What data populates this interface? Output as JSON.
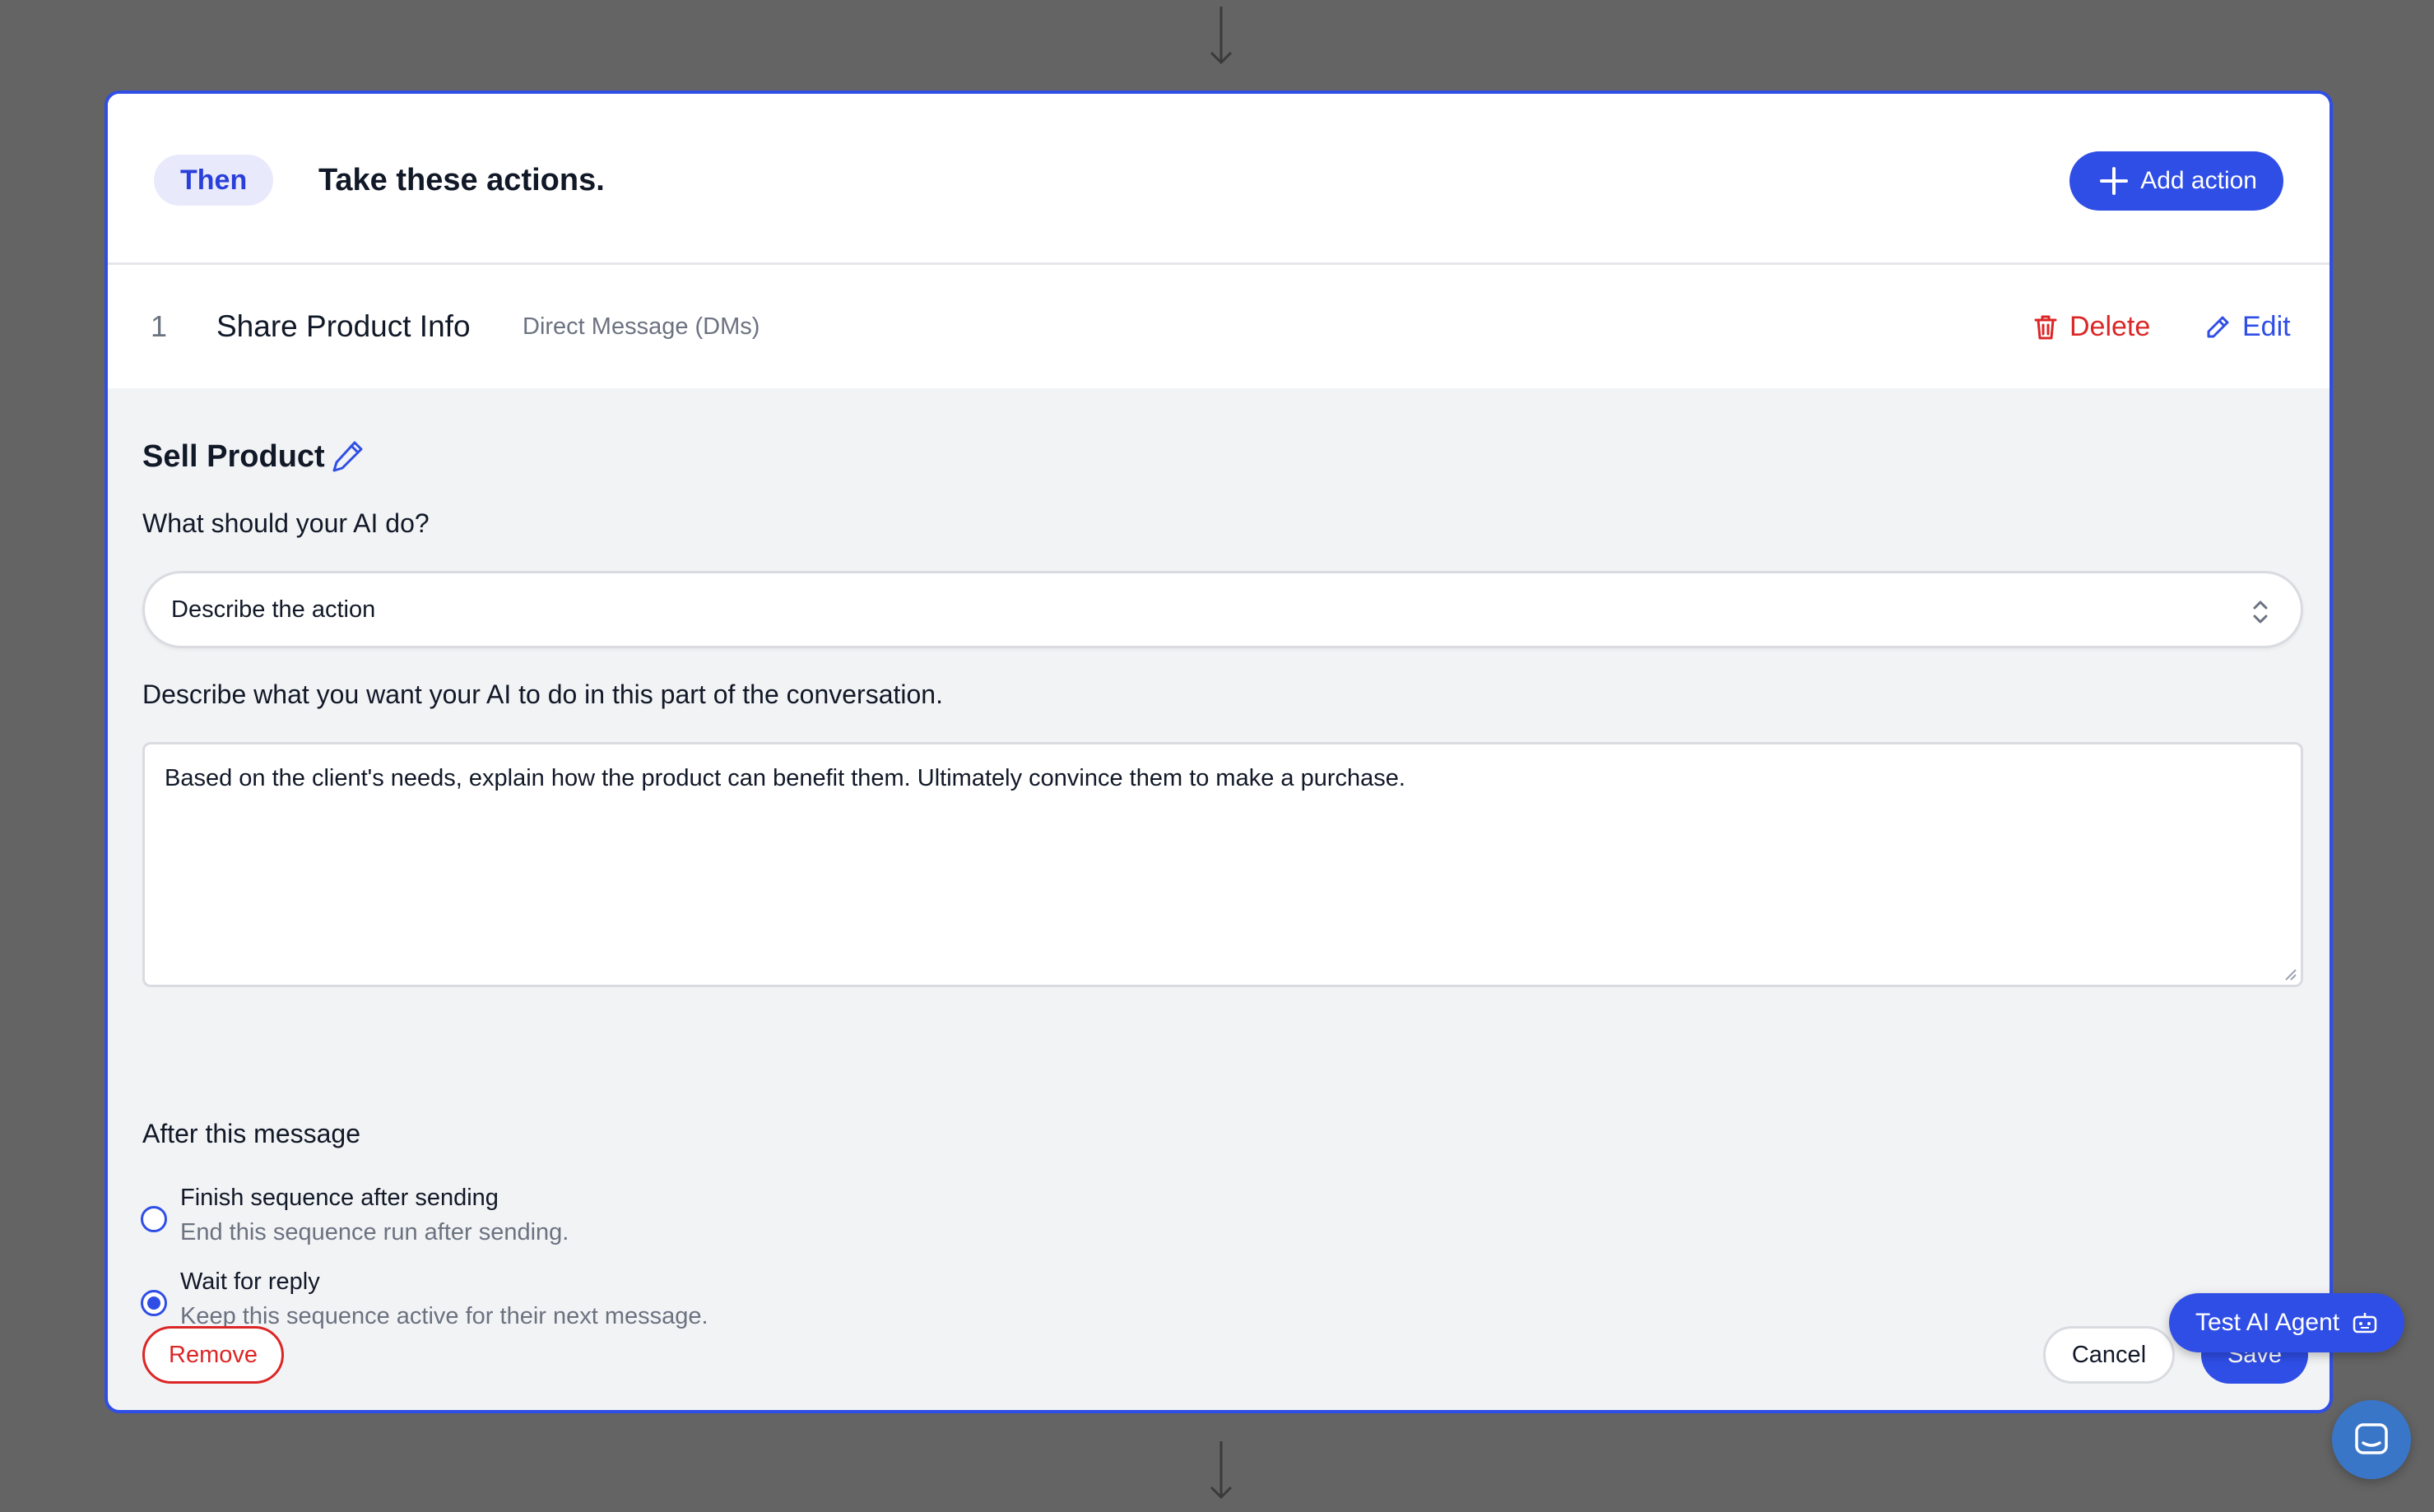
{
  "header": {
    "pill": "Then",
    "title": "Take these actions.",
    "add_action_label": "Add action"
  },
  "action_row": {
    "number": "1",
    "title": "Share Product Info",
    "channel": "Direct Message (DMs)",
    "delete_label": "Delete",
    "edit_label": "Edit"
  },
  "editor": {
    "section_title": "Sell Product",
    "what_label": "What should your AI do?",
    "action_type_value": "Describe the action",
    "describe_label": "Describe what you want your AI to do in this part of the conversation.",
    "description_value": "Based on the client's needs, explain how the product can benefit them. Ultimately convince them to make a purchase.",
    "after_label": "After this message",
    "options": [
      {
        "title": "Finish sequence after sending",
        "desc": "End this sequence run after sending.",
        "selected": false
      },
      {
        "title": "Wait for reply",
        "desc": "Keep this sequence active for their next message.",
        "selected": true
      }
    ],
    "remove_label": "Remove",
    "cancel_label": "Cancel",
    "save_label": "Save"
  },
  "floating": {
    "test_agent_label": "Test AI Agent"
  },
  "colors": {
    "accent": "#2f4ee6",
    "danger": "#dc2626",
    "overlay": "#646464"
  }
}
